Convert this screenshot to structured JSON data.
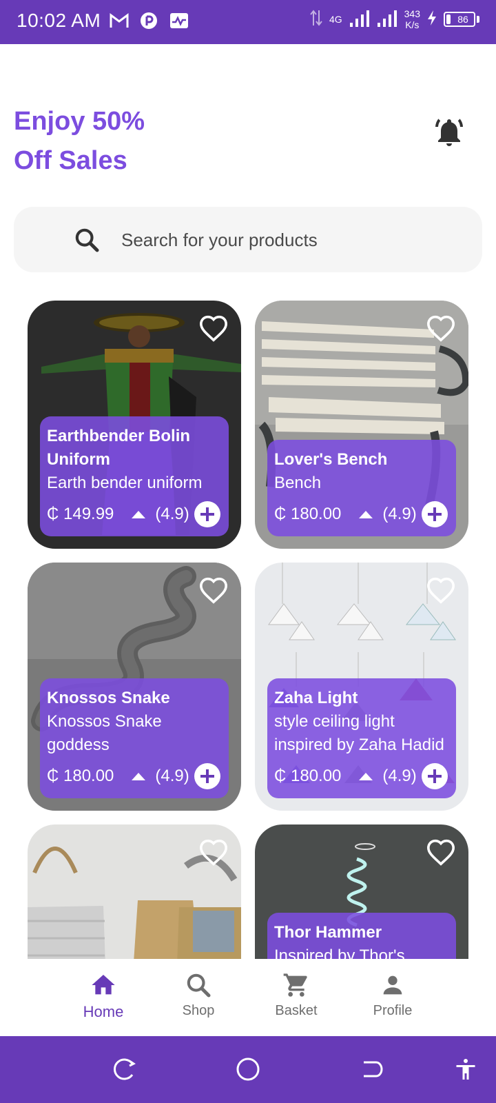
{
  "status_bar": {
    "time": "10:02 AM",
    "network_type": "4G",
    "speed_value": "343",
    "speed_unit": "K/s",
    "battery": "86",
    "icons": [
      "gmail-icon",
      "app-icon",
      "activity-icon",
      "data-arrows-icon",
      "signal-icon",
      "signal-icon",
      "charging-icon",
      "battery-icon"
    ]
  },
  "header": {
    "promo_line1": "Enjoy 50%",
    "promo_line2": "Off Sales",
    "notification_icon": "bell-icon"
  },
  "search": {
    "placeholder": "Search for your products",
    "icon": "search-icon"
  },
  "products": [
    {
      "name": "Earthbender Bolin Uniform",
      "description": "Earth bender uniform",
      "price": "₵ 149.99",
      "rating": "(4.9)",
      "image": "costume-figure"
    },
    {
      "name": "Lover's Bench",
      "description": "Bench",
      "price": "₵ 180.00",
      "rating": "(4.9)",
      "image": "park-bench"
    },
    {
      "name": "Knossos Snake",
      "description": "Knossos Snake goddess",
      "price": "₵ 180.00",
      "rating": "(4.9)",
      "image": "snake-sculpture"
    },
    {
      "name": "Zaha Light",
      "description": "style ceiling light inspired by Zaha Hadid",
      "price": "₵ 180.00",
      "rating": "(4.9)",
      "image": "pendant-lights"
    },
    {
      "name": "",
      "description": "",
      "price": "",
      "rating": "",
      "image": "woven-bags"
    },
    {
      "name": "Thor Hammer",
      "description": "Inspired by Thor's",
      "price": "",
      "rating": "",
      "image": "neon-light"
    }
  ],
  "bottom_nav": {
    "items": [
      {
        "label": "Home",
        "icon": "home-icon",
        "active": true
      },
      {
        "label": "Shop",
        "icon": "search-icon",
        "active": false
      },
      {
        "label": "Basket",
        "icon": "cart-icon",
        "active": false
      },
      {
        "label": "Profile",
        "icon": "person-icon",
        "active": false
      }
    ]
  },
  "colors": {
    "primary": "#673ab7",
    "accent": "#7c4ddf",
    "search_bg": "#f5f5f5",
    "inactive": "#6e6e6e"
  }
}
